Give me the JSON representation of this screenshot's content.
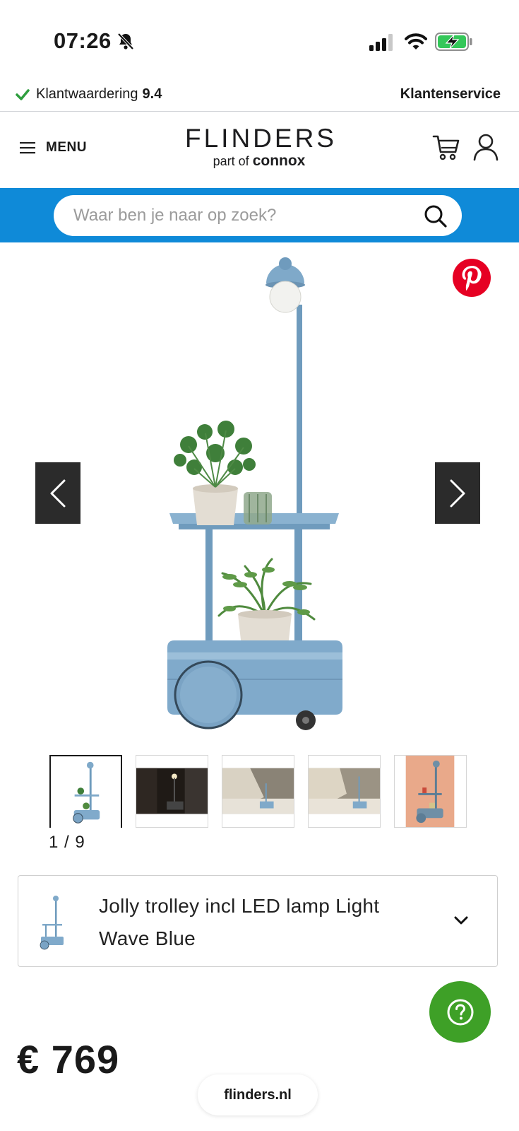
{
  "status_bar": {
    "time": "07:26",
    "icons": [
      "bell-slash-icon",
      "signal-icon",
      "wifi-icon",
      "battery-charging-icon"
    ]
  },
  "info_bar": {
    "rating_label": "Klantwaardering",
    "rating_score": "9.4",
    "service_link": "Klantenservice"
  },
  "header": {
    "menu_label": "MENU",
    "logo_text": "FLINDERS",
    "logo_sub_prefix": "part of",
    "logo_sub_brand": "connox"
  },
  "search": {
    "placeholder": "Waar ben je naar op zoek?"
  },
  "gallery": {
    "counter": "1 / 9",
    "thumbnail_count": 5,
    "active_index": 0
  },
  "product": {
    "variant_name": "Jolly trolley incl LED lamp Light Wave Blue",
    "price": "€ 769"
  },
  "browser": {
    "url": "flinders.nl"
  },
  "colors": {
    "brand_blue": "#0f8ad8",
    "help_green": "#3ea027",
    "pinterest_red": "#e60023",
    "check_green": "#2e9e3e",
    "product_blue": "#7fa9c9"
  }
}
